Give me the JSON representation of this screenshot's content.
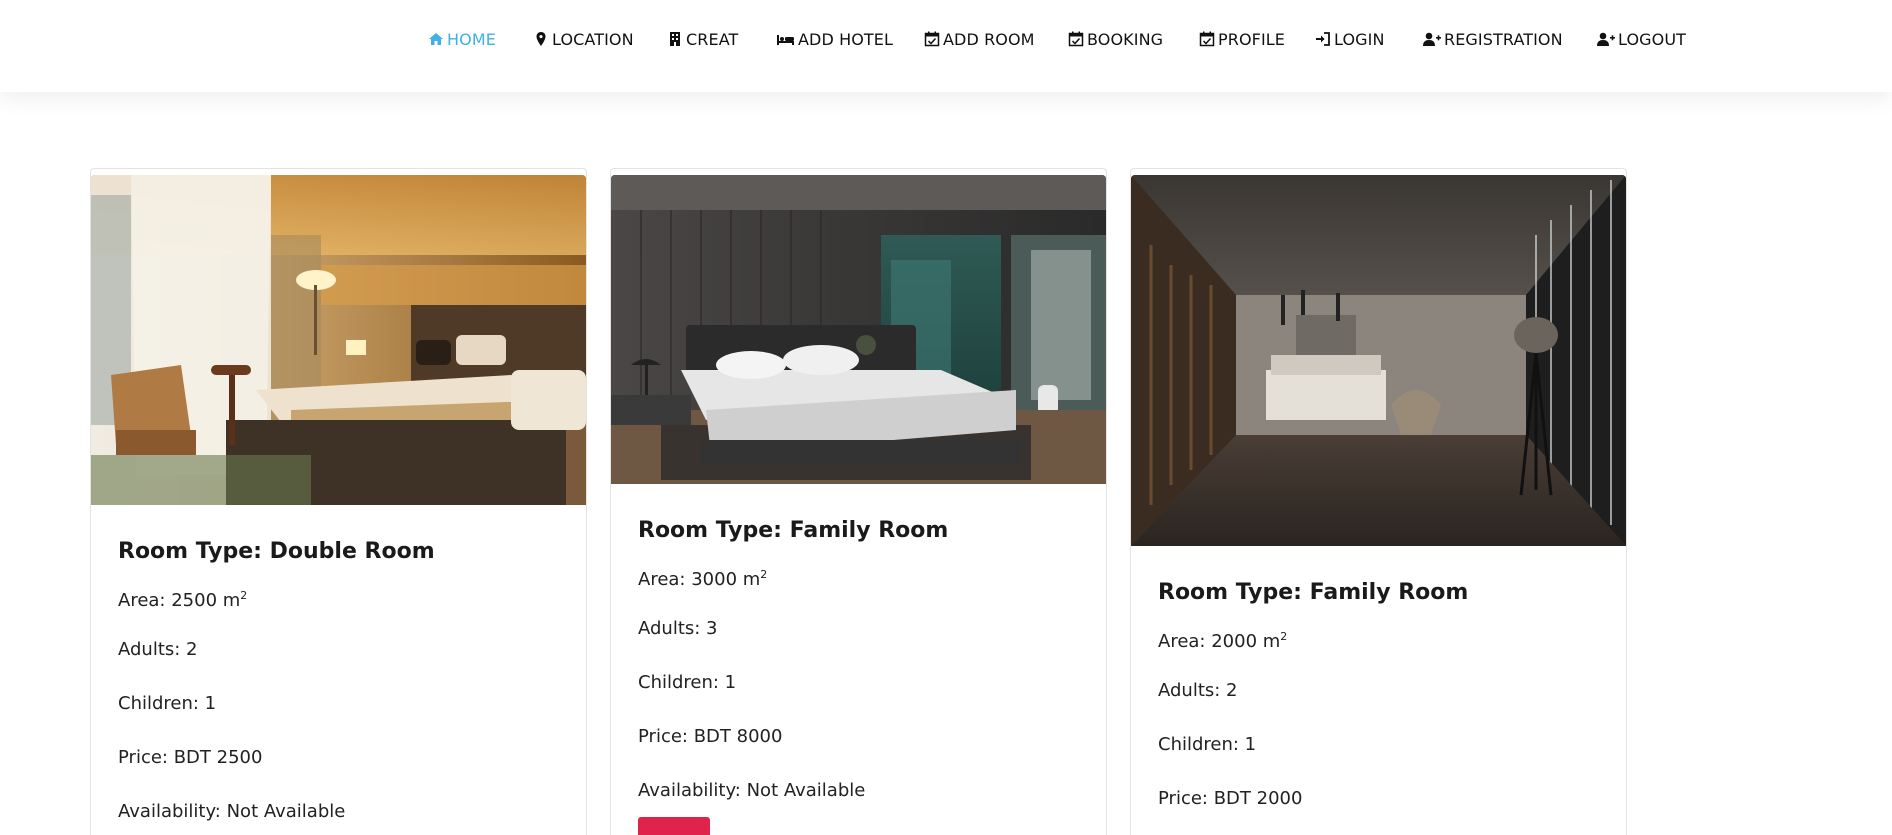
{
  "nav": {
    "items": [
      {
        "label": "HOME",
        "icon": "home-icon",
        "active": true
      },
      {
        "label": "LOCATION",
        "icon": "map-marker-icon"
      },
      {
        "label": "CREAT",
        "icon": "building-icon"
      },
      {
        "label": "ADD HOTEL",
        "icon": "bed-icon"
      },
      {
        "label": "ADD ROOM",
        "icon": "calendar-check-icon"
      },
      {
        "label": "BOOKING",
        "icon": "calendar-check-icon"
      },
      {
        "label": "PROFILE",
        "icon": "calendar-check-icon"
      },
      {
        "label": "LOGIN",
        "icon": "sign-in-icon"
      },
      {
        "label": "REGISTRATION",
        "icon": "user-plus-icon"
      },
      {
        "label": "LOGOUT",
        "icon": "user-plus-icon"
      }
    ],
    "active_color": "#3fb1e4"
  },
  "rooms": [
    {
      "title": "Room Type: Double Room",
      "area": "Area: 2500 m",
      "area_unit_sup": "2",
      "adults": "Adults: 2",
      "children": "Children: 1",
      "price": "Price: BDT 2500",
      "availability": "Availability: Not Available",
      "image": "warm-hotel-bedroom-photo"
    },
    {
      "title": "Room Type: Family Room",
      "area": "Area: 3000 m",
      "area_unit_sup": "2",
      "adults": "Adults: 3",
      "children": "Children: 1",
      "price": "Price: BDT 8000",
      "availability": "Availability: Not Available",
      "image": "dark-modern-bedroom-photo"
    },
    {
      "title": "Room Type: Family Room",
      "area": "Area: 2000 m",
      "area_unit_sup": "2",
      "adults": "Adults: 2",
      "children": "Children: 1",
      "price": "Price: BDT 2000",
      "image": "industrial-loft-bedroom-photo"
    }
  ],
  "colors": {
    "accent": "#3fb1e4",
    "button": "#e0234a"
  }
}
